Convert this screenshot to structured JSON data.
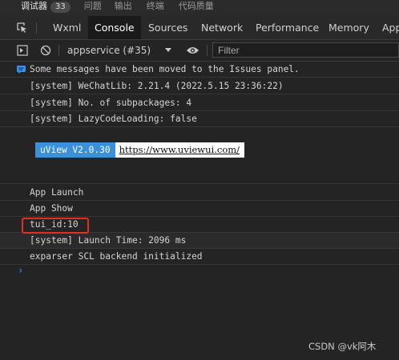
{
  "top_tabs": [
    {
      "label": "调试器",
      "badge": "33"
    },
    {
      "label": "问题"
    },
    {
      "label": "输出"
    },
    {
      "label": "终端"
    },
    {
      "label": "代码质量"
    }
  ],
  "dev_tabs": [
    "Wxml",
    "Console",
    "Sources",
    "Network",
    "Performance",
    "Memory",
    "App"
  ],
  "toolbar": {
    "context": "appservice (#35)",
    "filter_placeholder": "Filter"
  },
  "console": {
    "info_message": "Some messages have been moved to the Issues panel.",
    "lines_top": [
      "[system] WeChatLib: 2.21.4 (2022.5.15 23:36:22)",
      "[system] No. of subpackages: 4",
      "[system] LazyCodeLoading: false"
    ],
    "banner_left": "uView V2.0.30",
    "banner_right": "https://www.uviewui.com/",
    "lines_bottom": [
      "App Launch",
      "App Show",
      "tui_id:10",
      "[system] Launch Time: 2096 ms",
      "exparser SCL backend initialized"
    ],
    "prompt": "›"
  },
  "watermark": "CSDN @vk阿木",
  "colors": {
    "accent_blue": "#3b8eea",
    "banner_blue": "#3c8fd9",
    "highlight_red": "#e03024"
  }
}
